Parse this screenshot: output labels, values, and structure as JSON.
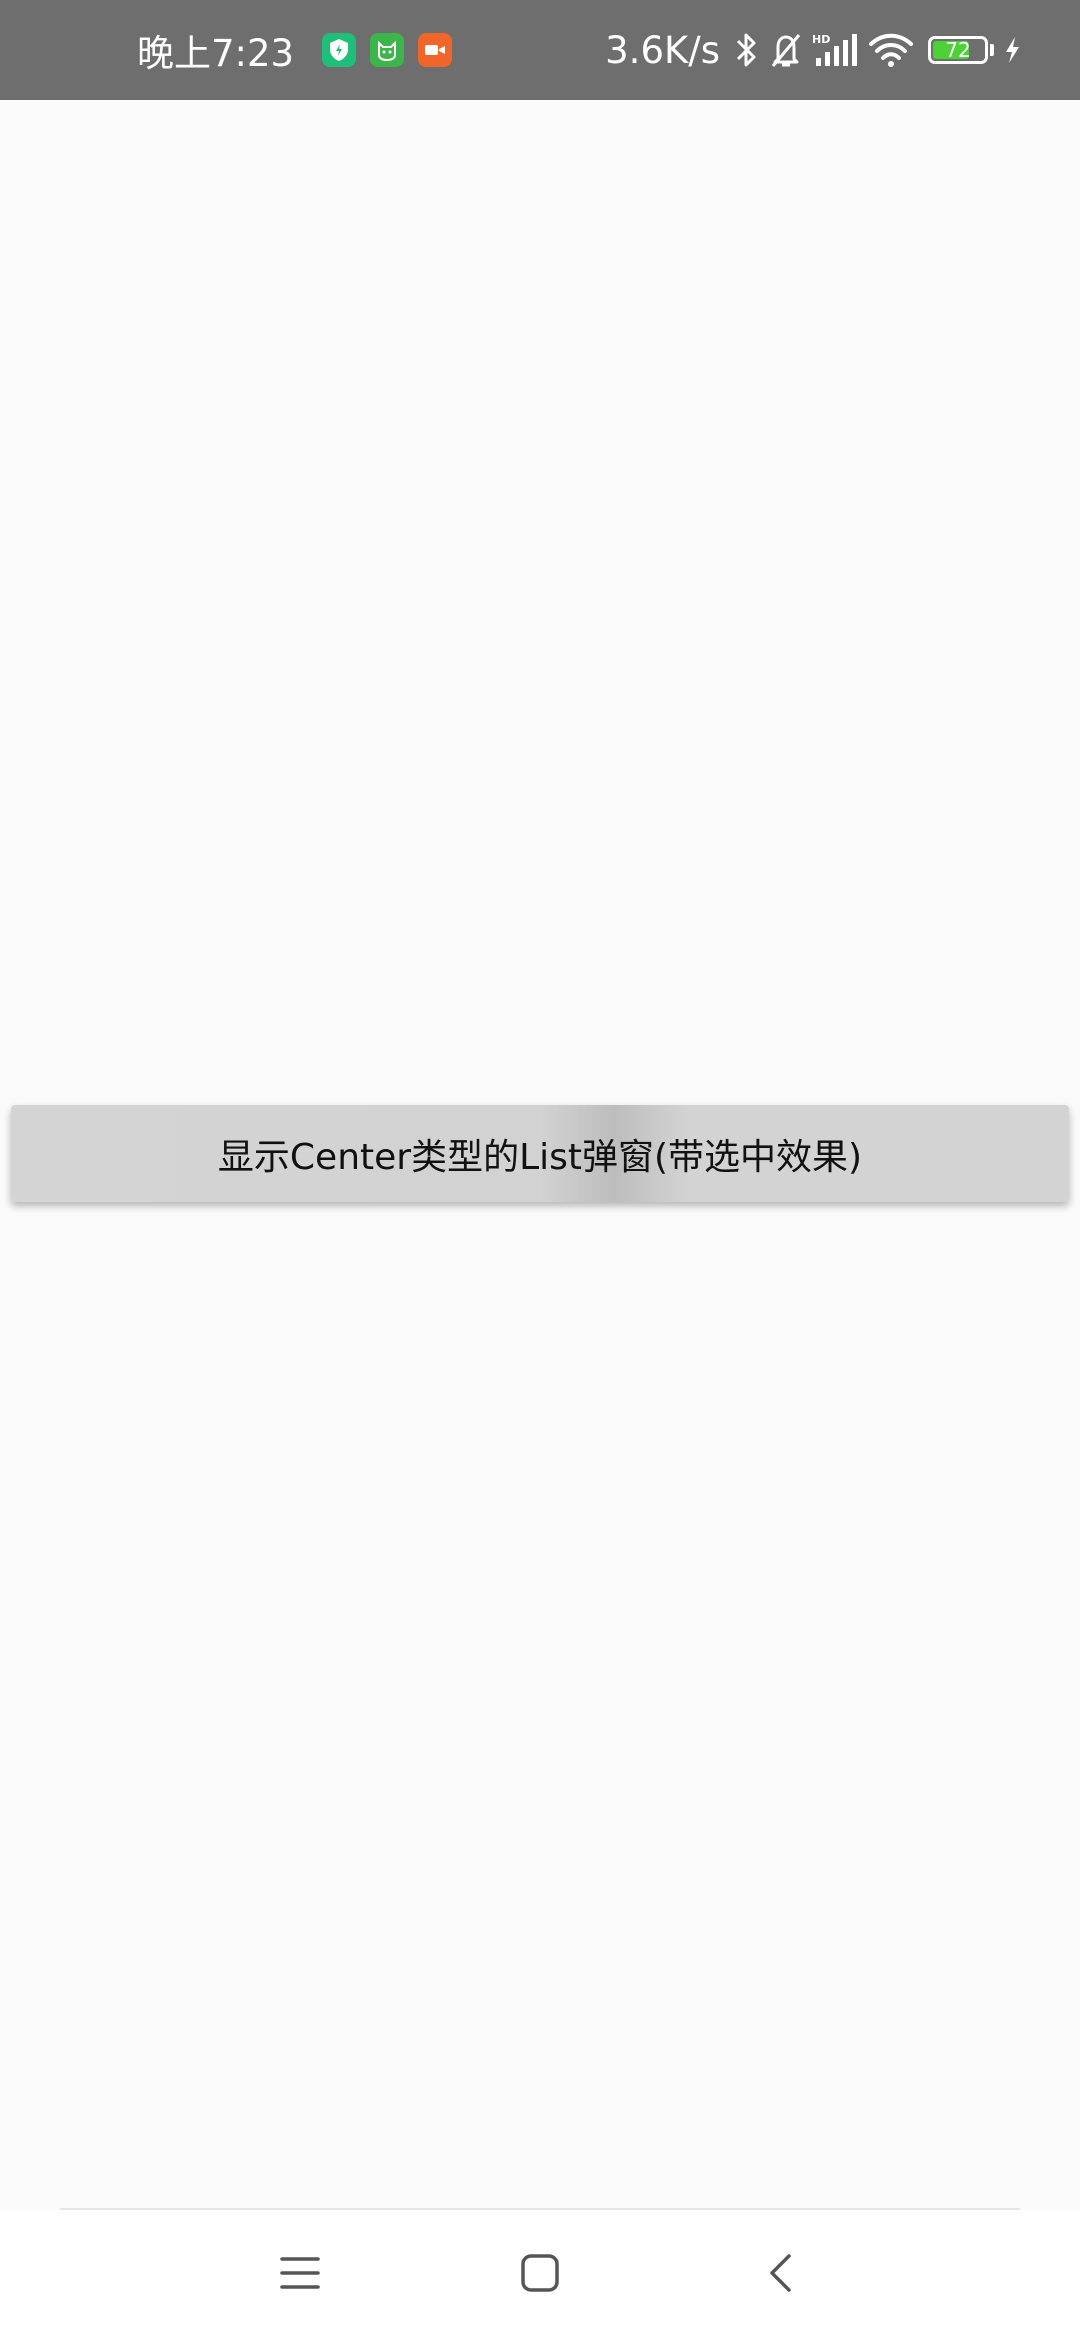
{
  "status_bar": {
    "time": "晚上7:23",
    "net_speed": "3.6K/s",
    "battery_level": "72",
    "battery_fraction": 0.72,
    "icons": {
      "app1": "shield-app-icon",
      "app2": "cat-app-icon",
      "app3": "video-camera-app-icon",
      "bluetooth": "bluetooth-icon",
      "mute": "bell-off-icon",
      "signal": "hd-signal-icon",
      "wifi": "wifi-icon",
      "charging": "lightning-icon"
    },
    "colors": {
      "app1": "#1fbf7a",
      "app2": "#3cb64a",
      "app3": "#f0652a",
      "battery_fill": "#4cd137"
    }
  },
  "main": {
    "button_label": "显示Center类型的List弹窗(带选中效果)"
  },
  "nav_bar": {
    "icons": {
      "menu": "menu-icon",
      "home": "home-square-icon",
      "back": "back-chevron-icon"
    }
  }
}
